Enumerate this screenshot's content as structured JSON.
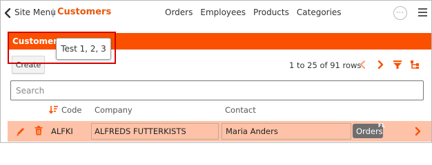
{
  "nav": {
    "site_menu": "Site Menu",
    "separator": "|",
    "app_title": "Customers",
    "links": [
      "Orders",
      "Employees",
      "Products",
      "Categories"
    ],
    "more_label": "···"
  },
  "bar": {
    "title": "Customers"
  },
  "tooltip": {
    "text": "Test 1, 2, 3"
  },
  "toolbar": {
    "create_label": "Create"
  },
  "pager": {
    "text": "1 to 25 of 91 rows"
  },
  "search": {
    "placeholder": "Search",
    "value": ""
  },
  "table": {
    "columns": [
      "Code",
      "Company",
      "Contact"
    ],
    "rows": [
      {
        "code": "ALFKI",
        "company": "ALFREDS FUTTERKISTS",
        "contact": "Maria Anders",
        "action": "Orders",
        "badge": "FL"
      }
    ]
  },
  "colors": {
    "accent": "#fb5000",
    "row_highlight": "#fdc2a8",
    "annotation": "#d40000"
  },
  "icons": [
    "back-icon",
    "more-icon",
    "menu-icon",
    "prev-page-icon",
    "next-page-icon",
    "filter-icon",
    "hierarchy-icon",
    "sort-desc-icon",
    "edit-icon",
    "trash-icon",
    "chevron-right-icon"
  ]
}
